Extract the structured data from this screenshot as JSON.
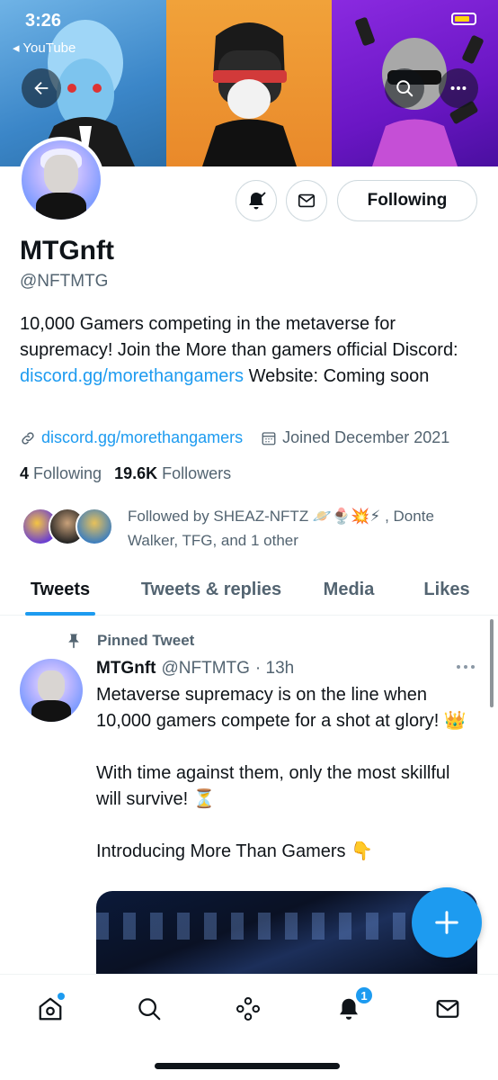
{
  "status": {
    "time": "3:26",
    "back_app": "◂ YouTube"
  },
  "profile": {
    "name": "MTGnft",
    "handle": "@NFTMTG",
    "follow_label": "Following",
    "bio_part1": "10,000 Gamers competing in the metaverse for supremacy! Join the More than gamers official Discord: ",
    "bio_link": "discord.gg/morethangamers",
    "bio_part2": " Website: Coming soon",
    "website": "discord.gg/morethangamers",
    "joined": "Joined December 2021",
    "following_count": "4",
    "following_label": "Following",
    "followers_count": "19.6K",
    "followers_label": "Followers",
    "followed_by": "Followed by SHEAZ-NFTZ 🪐🍨💥⚡ , Donte Walker, TFG, and 1 other"
  },
  "tabs": [
    {
      "label": "Tweets"
    },
    {
      "label": "Tweets & replies"
    },
    {
      "label": "Media"
    },
    {
      "label": "Likes"
    }
  ],
  "tweet": {
    "pinned_label": "Pinned Tweet",
    "name": "MTGnft",
    "handle": "@NFTMTG",
    "time": "· 13h",
    "para1": "Metaverse supremacy is on the line when 10,000 gamers compete for a shot at glory! 👑",
    "para2": "With time against them, only the most skillful will survive! ⏳",
    "para3": "Introducing More Than Gamers 👇"
  },
  "nav": {
    "notif_badge": "1"
  },
  "colors": {
    "accent": "#1d9bf0",
    "text": "#0f1419",
    "muted": "#536471"
  }
}
